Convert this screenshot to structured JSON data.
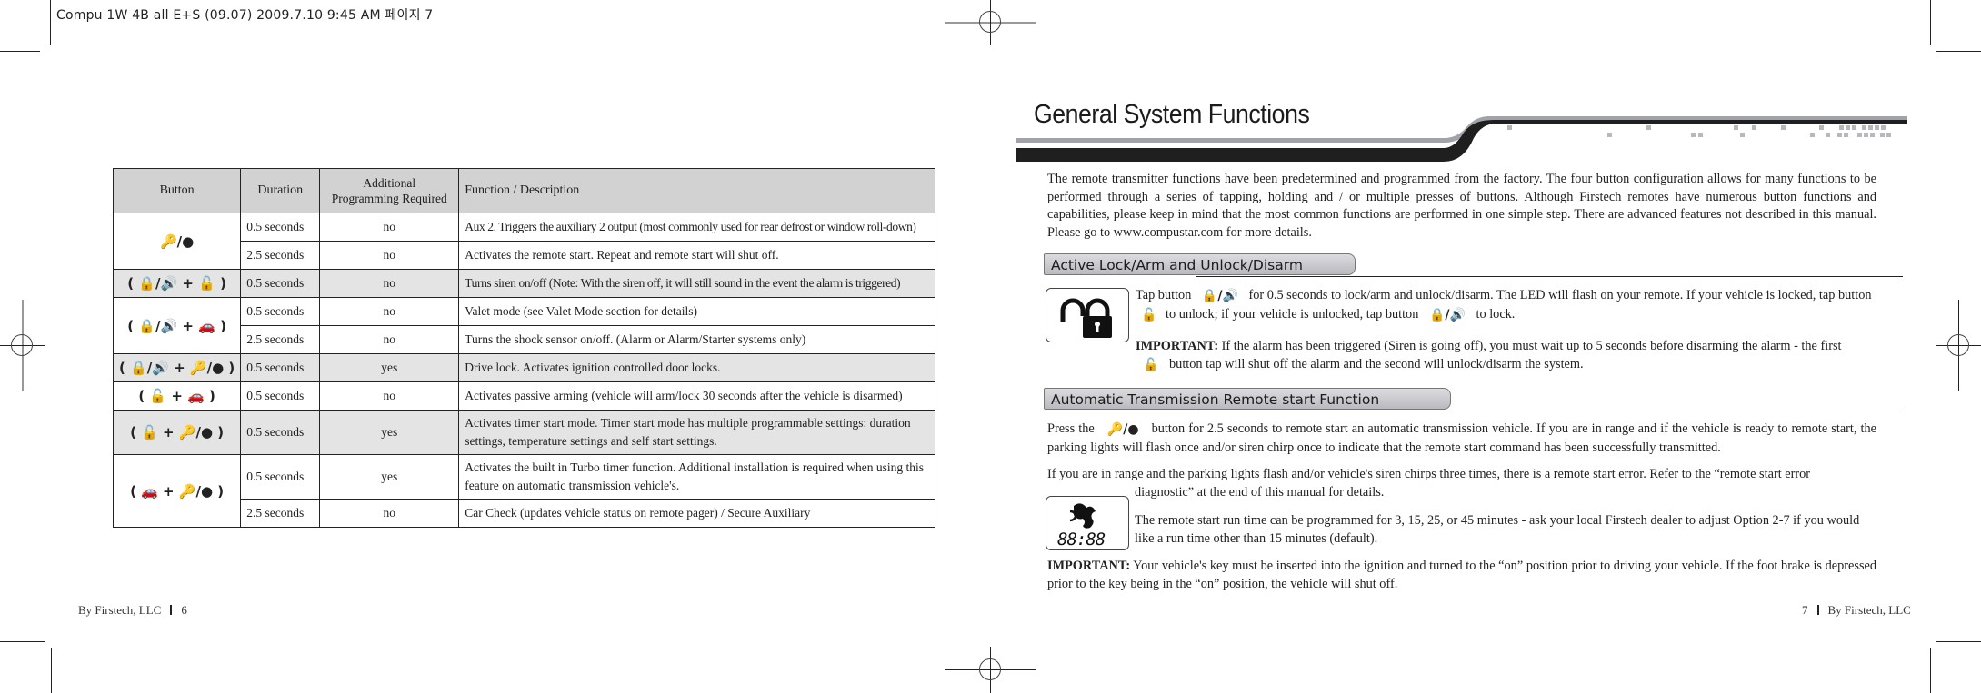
{
  "slug": "Compu 1W 4B all E+S (09.07)  2009.7.10 9:45 AM 페이지 7",
  "left_page": {
    "table": {
      "headers": [
        "Button",
        "Duration",
        "Additional Programming Required",
        "Function / Description"
      ],
      "header_addl_line1": "Additional",
      "header_addl_line2": "Programming Required",
      "rows": [
        {
          "button": "🔑/●",
          "duration": "0.5 seconds",
          "programming": "no",
          "function": "Aux 2. Triggers the auxiliary 2 output (most commonly used for rear defrost or window roll-down)"
        },
        {
          "button": "",
          "duration": "2.5 seconds",
          "programming": "no",
          "function": "Activates the remote start. Repeat and remote start will shut off."
        },
        {
          "button": "( 🔒/🔊 + 🔓 )",
          "duration": "0.5 seconds",
          "programming": "no",
          "function": "Turns siren on/off (Note:  With the siren off, it will still sound in the event the alarm is triggered)"
        },
        {
          "button": "( 🔒/🔊 + 🚗 )",
          "duration": "0.5 seconds",
          "programming": "no",
          "function": "Valet mode (see Valet Mode section for details)"
        },
        {
          "button": "",
          "duration": "2.5 seconds",
          "programming": "no",
          "function": "Turns the shock sensor on/off. (Alarm or Alarm/Starter systems only)"
        },
        {
          "button": "( 🔒/🔊 + 🔑/● )",
          "duration": "0.5 seconds",
          "programming": "yes",
          "function": "Drive lock. Activates ignition controlled door locks."
        },
        {
          "button": "( 🔓 + 🚗 )",
          "duration": "0.5 seconds",
          "programming": "no",
          "function": "Activates passive arming (vehicle will arm/lock 30 seconds after the vehicle is disarmed)"
        },
        {
          "button": "( 🔓 + 🔑/● )",
          "duration": "0.5 seconds",
          "programming": "yes",
          "function": "Activates timer start mode. Timer start mode has multiple programmable settings: duration settings, temperature settings and self start settings."
        },
        {
          "button": "( 🚗 + 🔑/● )",
          "duration": "0.5 seconds",
          "programming": "yes",
          "function": "Activates the built in Turbo timer function. Additional installation is required when using this feature on automatic transmission vehicle's."
        },
        {
          "button": "",
          "duration": "2.5 seconds",
          "programming": "no",
          "function": "Car Check (updates vehicle status on remote pager) / Secure Auxiliary"
        }
      ],
      "button_groups": [
        {
          "label_parts": [
            "key-led"
          ],
          "display": "🔑/●"
        },
        {
          "display": "( 🔒/🔊 + 🔓 )"
        },
        {
          "display": "( 🔒/🔊 + 🚗 )"
        },
        {
          "display": "( 🔒/🔊 + 🔑/● )"
        },
        {
          "display": "( 🔓 + 🚗 )"
        },
        {
          "display": "( 🔓 + 🔑/● )"
        },
        {
          "display": "( 🚗 + 🔑/● )"
        }
      ]
    },
    "footer": {
      "publisher": "By Firstech, LLC",
      "page": "6"
    }
  },
  "right_page": {
    "title": "General System Functions",
    "intro": "The remote transmitter functions have been predetermined and programmed from the factory. The four button configuration allows for many functions to be performed through a series of tapping, holding and / or multiple presses of buttons. Although Firstech remotes have numerous button functions and capabilities, please keep in mind that the most common functions are performed in one simple step. There are advanced features not described in this manual. Please go to www.compustar.com for more details.",
    "section1": {
      "heading": "Active Lock/Arm and Unlock/Disarm",
      "p1_a": "Tap button",
      "p1_b": "for 0.5 seconds to lock/arm and unlock/disarm. The LED will flash on your remote. If your vehicle is locked, tap",
      "p1_c": "button",
      "p1_d": "to unlock; if your vehicle is unlocked, tap button",
      "p1_e": "to lock.",
      "important_label": "IMPORTANT:",
      "p2_a": "If the alarm has been triggered (Siren is going off), you must wait up to 5 seconds before disarming the alarm - the",
      "p2_b": "first",
      "p2_c": "button tap will shut off the alarm and the second will unlock/disarm the system.",
      "icon_lock_siren": "🔒/🔊",
      "icon_unlock": "🔓"
    },
    "section2": {
      "heading": "Automatic Transmission Remote start Function",
      "p1_a": "Press the",
      "p1_icon": "🔑/●",
      "p1_b": "button for 2.5 seconds to remote start an automatic transmission vehicle. If you are in range and if the vehicle is ready to remote start, the parking lights will flash once and/or siren chirp once to indicate that the remote start command has been successfully transmitted.",
      "p2_a": "If you are in range and the parking lights flash and/or vehicle's siren chirps three times, there is a remote start error. Refer to the “remote start error",
      "p2_b": "diagnostic” at the end of this manual for details.",
      "p3": "The remote start run time can be programmed for 3, 15, 25, or 45 minutes - ask your local Firstech dealer to adjust Option 2-7 if you would like a run time other than 15 minutes (default).",
      "display_digits": "88:88",
      "important_label": "IMPORTANT:",
      "p4": "Your vehicle's key must be inserted into the ignition and turned to the “on” position prior to driving your vehicle. If the foot brake is depressed prior to the key being in the “on” position, the vehicle will shut off."
    },
    "footer": {
      "page": "7",
      "publisher": "By Firstech, LLC"
    }
  }
}
